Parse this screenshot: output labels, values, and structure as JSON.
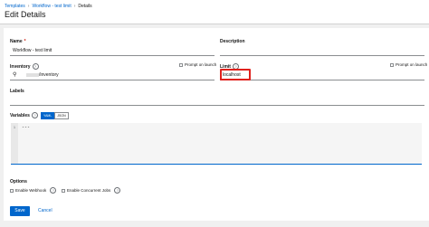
{
  "breadcrumb": {
    "items": [
      "Templates",
      "Workflow - test limit",
      "Details"
    ]
  },
  "page": {
    "title": "Edit Details"
  },
  "form": {
    "name": {
      "label": "Name",
      "required_mark": "*",
      "value": "Workflow - test limit"
    },
    "description": {
      "label": "Description",
      "value": ""
    },
    "inventory": {
      "label": "Inventory",
      "value": "/inventory",
      "prompt_label": "Prompt on launch"
    },
    "limit": {
      "label": "Limit",
      "value": "localhost",
      "prompt_label": "Prompt on launch"
    },
    "labels": {
      "label": "Labels"
    },
    "variables": {
      "label": "Variables",
      "modes": [
        "YAML",
        "JSON"
      ],
      "active_mode": "YAML",
      "line_number": "1",
      "content": "---"
    },
    "options": {
      "label": "Options",
      "enable_webhook": "Enable Webhook",
      "enable_concurrent_jobs": "Enable Concurrent Jobs"
    }
  },
  "actions": {
    "save": "Save",
    "cancel": "Cancel"
  },
  "icons": {
    "help": "?",
    "search": "search-icon"
  },
  "colors": {
    "primary": "#0066cc",
    "highlight": "#e0211d"
  }
}
